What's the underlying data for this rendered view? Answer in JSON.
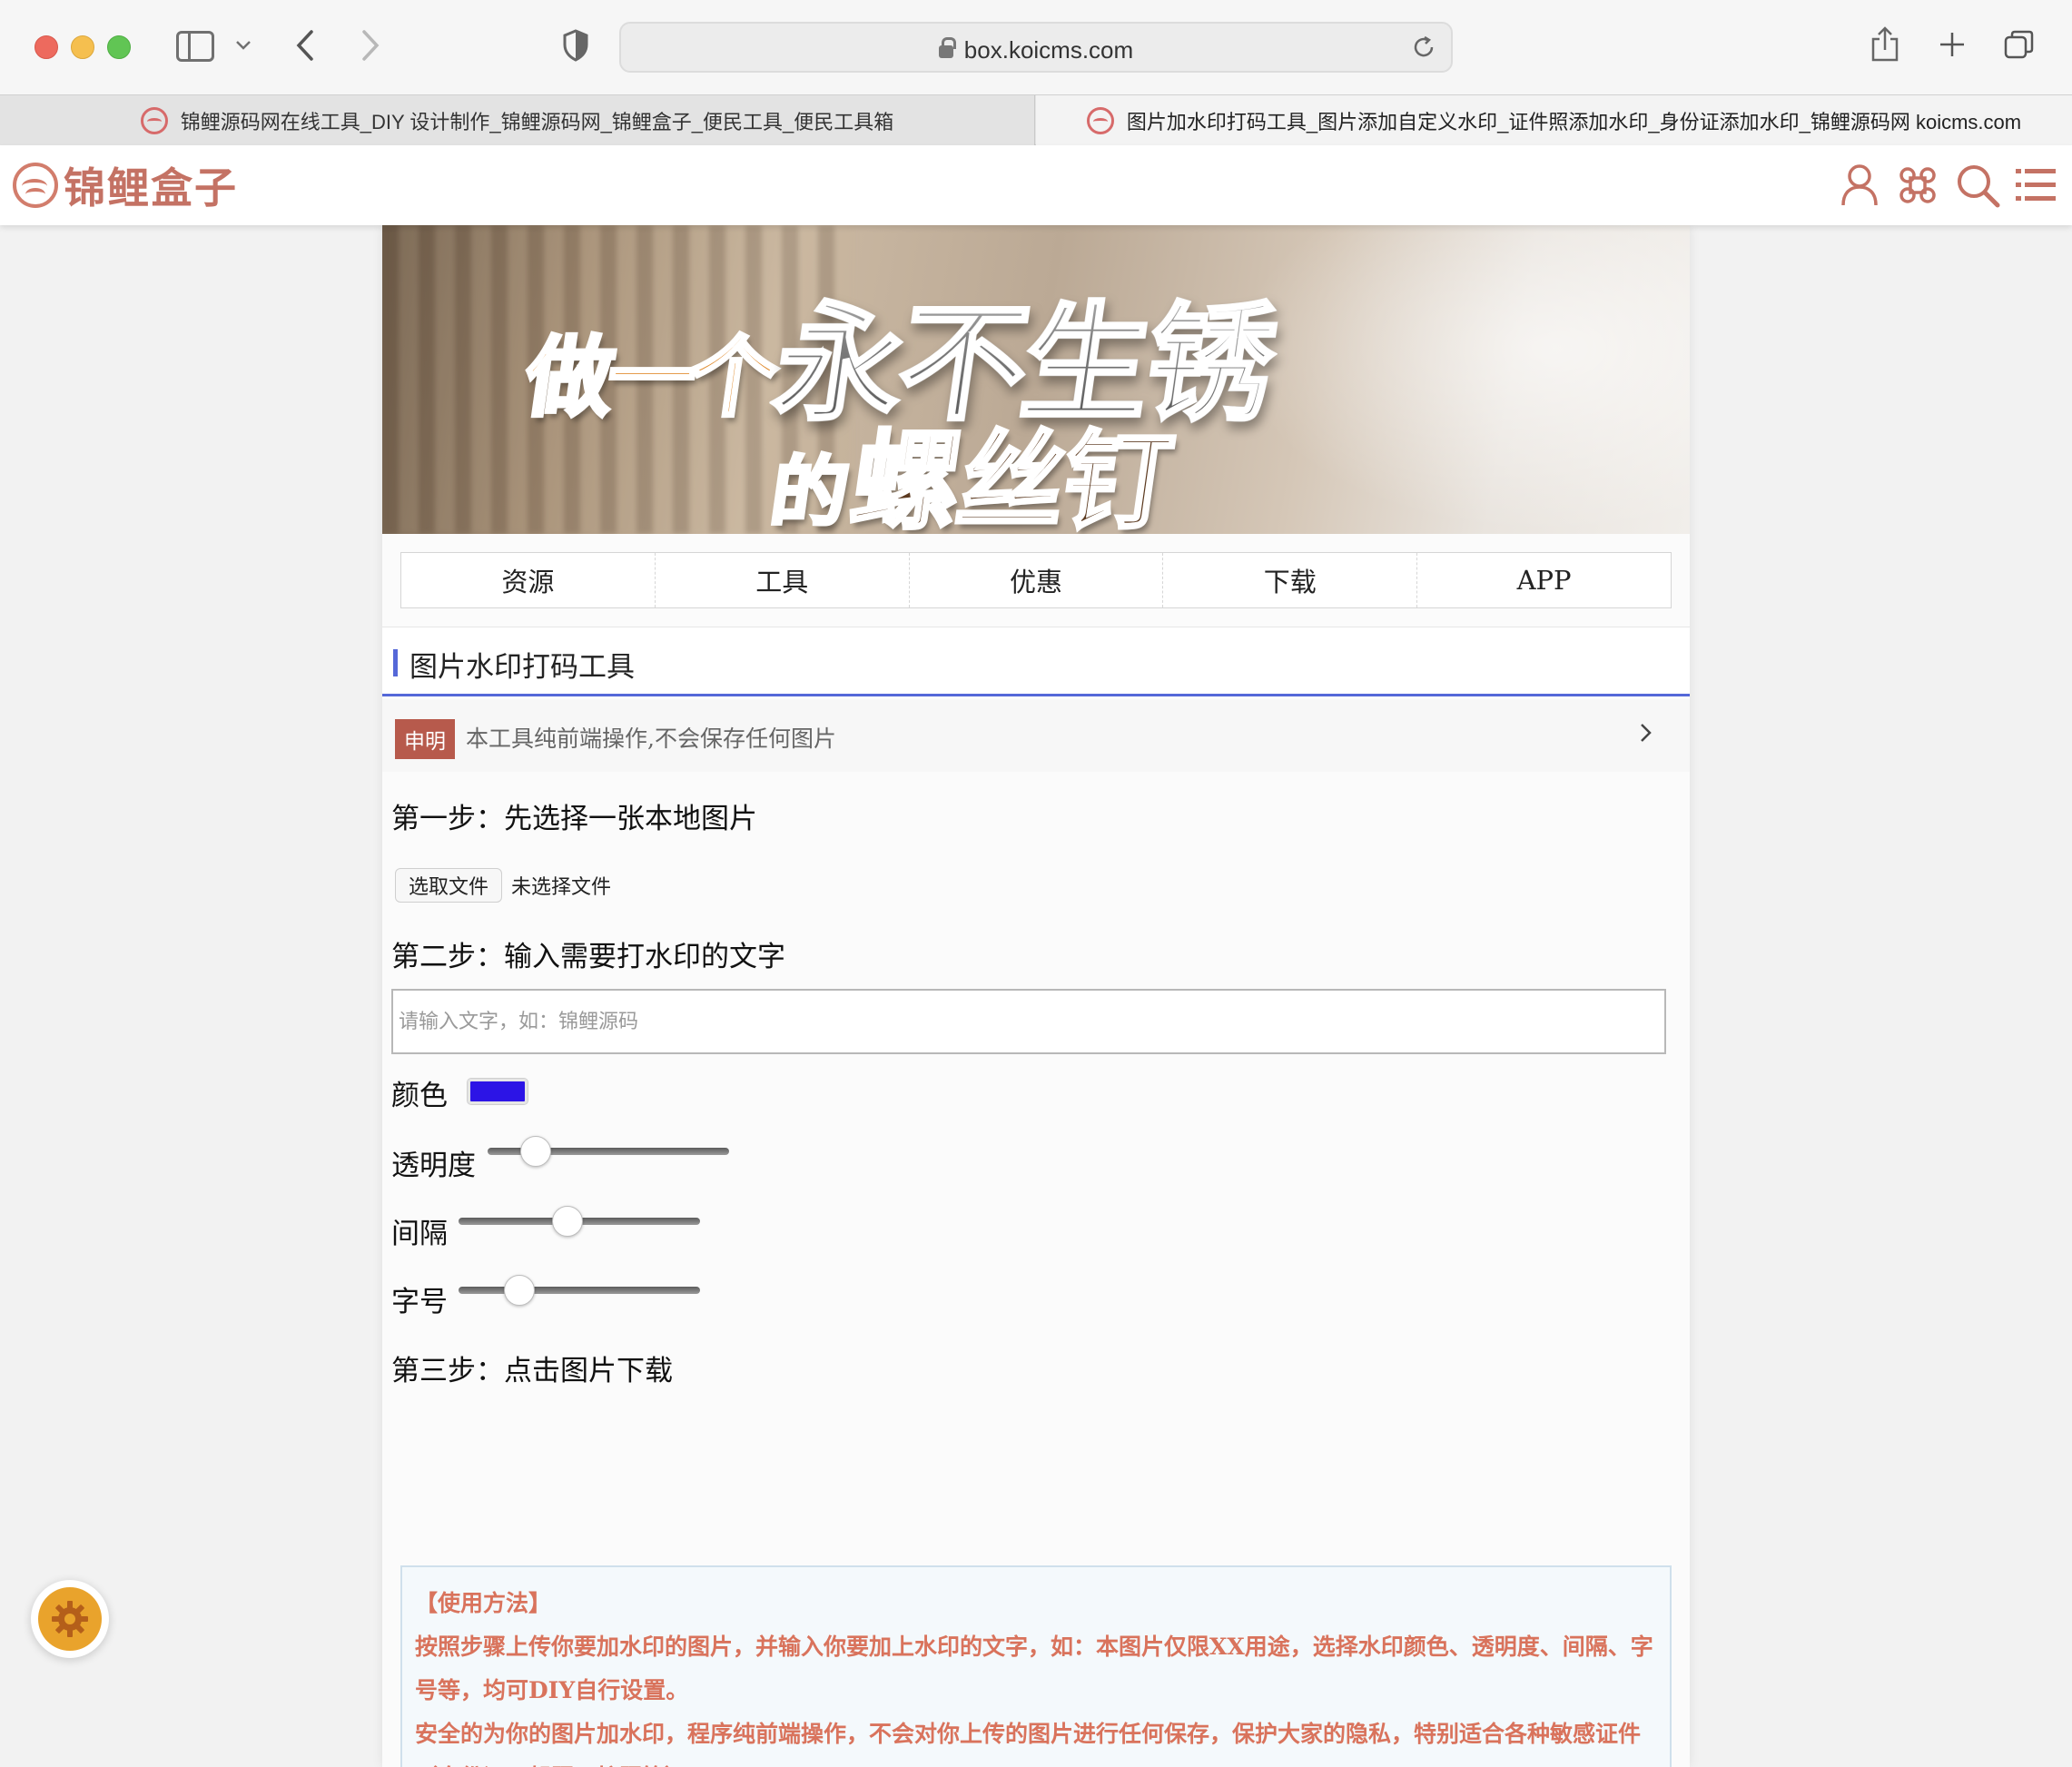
{
  "browser": {
    "url": "box.koicms.com",
    "tabs": [
      {
        "title": "锦鲤源码网在线工具_DIY 设计制作_锦鲤源码网_锦鲤盒子_便民工具_便民工具箱",
        "active": false
      },
      {
        "title": "图片加水印打码工具_图片添加自定义水印_证件照添加水印_身份证添加水印_锦鲤源码网 koicms.com",
        "active": true
      }
    ]
  },
  "site": {
    "logo_text": "锦鲤盒子",
    "header_icons": [
      "user-icon",
      "apps-icon",
      "search-icon",
      "menu-icon"
    ],
    "accent_color": "#c47264"
  },
  "banner": {
    "line1_small": "做一个",
    "line1_big": "永不生锈",
    "line2_small": "的",
    "line2_big": "螺丝钉"
  },
  "nav": {
    "items": [
      {
        "label": "资源"
      },
      {
        "label": "工具"
      },
      {
        "label": "优惠"
      },
      {
        "label": "下载"
      },
      {
        "label": "APP"
      }
    ]
  },
  "tool": {
    "title": "图片水印打码工具",
    "notice_badge": "申明",
    "notice_text": "本工具纯前端操作,不会保存任何图片",
    "step1": "第一步：先选择一张本地图片",
    "file_button": "选取文件",
    "file_status": "未选择文件",
    "step2": "第二步：输入需要打水印的文字",
    "text_value": "",
    "text_placeholder": "请输入文字，如：锦鲤源码",
    "color_label": "颜色",
    "color_value": "#2c14e6",
    "opacity_label": "透明度",
    "opacity_value": 0.2,
    "spacing_label": "间隔",
    "spacing_value": 0.45,
    "fontsize_label": "字号",
    "fontsize_value": 0.25,
    "step3": "第三步：点击图片下载"
  },
  "usage": {
    "title": "【使用方法】",
    "p1": "按照步骤上传你要加水印的图片，并输入你要加上水印的文字，如：本图片仅限XX用途，选择水印颜色、透明度、间隔、字号等，均可DIY自行设置。",
    "p2": "安全的为你的图片加水印，程序纯前端操作，不会对你上传的图片进行任何保存，保护大家的隐私，特别适合各种敏感证件（身份证、驾照、护照等）"
  }
}
